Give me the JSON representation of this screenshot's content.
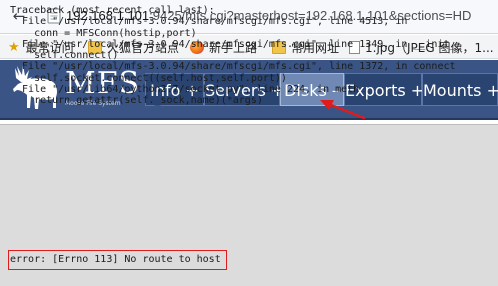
{
  "browser": {
    "url_host": "192.168.1.101",
    "url_rest": ":9425/mfs.cgi?masterhost=192.168.1.101&sections=HD"
  },
  "bookmarks": [
    {
      "label": "最常访问",
      "icon": "star-icon"
    },
    {
      "label": "火狐官方站点",
      "icon": "folder-icon"
    },
    {
      "label": "新手上路",
      "icon": "firefox-icon"
    },
    {
      "label": "常用网址",
      "icon": "folder-icon"
    },
    {
      "label": "1.jpg（JPEG 图像，1...",
      "icon": "file-icon"
    }
  ],
  "header": {
    "logo_text": "MFS",
    "logo_subtitle": "Moose File System"
  },
  "tabs": [
    {
      "label": "Info +",
      "active": false
    },
    {
      "label": "Servers +",
      "active": false
    },
    {
      "label": "Disks –",
      "active": true
    },
    {
      "label": "Exports +",
      "active": false
    },
    {
      "label": "Mounts +",
      "active": false
    }
  ],
  "traceback_lines": [
    "Traceback (most recent call last):",
    "  File \"/usr/local/mfs-3.0.94/share/mfscgi/mfs.cgi\", line 4513, in",
    "    conn = MFSConn(hostip,port)",
    "  File \"/usr/local/mfs-3.0.94/share/mfscgi/mfs.cgi\", line 1349, in __init__",
    "    self.connect()",
    "  File \"/usr/local/mfs-3.0.94/share/mfscgi/mfs.cgi\", line 1372, in connect",
    "    self.socket.connect((self.host,self.port))",
    "  File \"/usr/lib64/python2.7/socket.py\", line 224, in meth",
    "    return getattr(self._sock,name)(*args)"
  ],
  "error_message": "error: [Errno 113] No route to host",
  "colors": {
    "header_bg": "#3a5585",
    "tab_bg": "#2a4471",
    "tab_active_bg": "#7089b4",
    "annotation_red": "#e01b1b"
  }
}
